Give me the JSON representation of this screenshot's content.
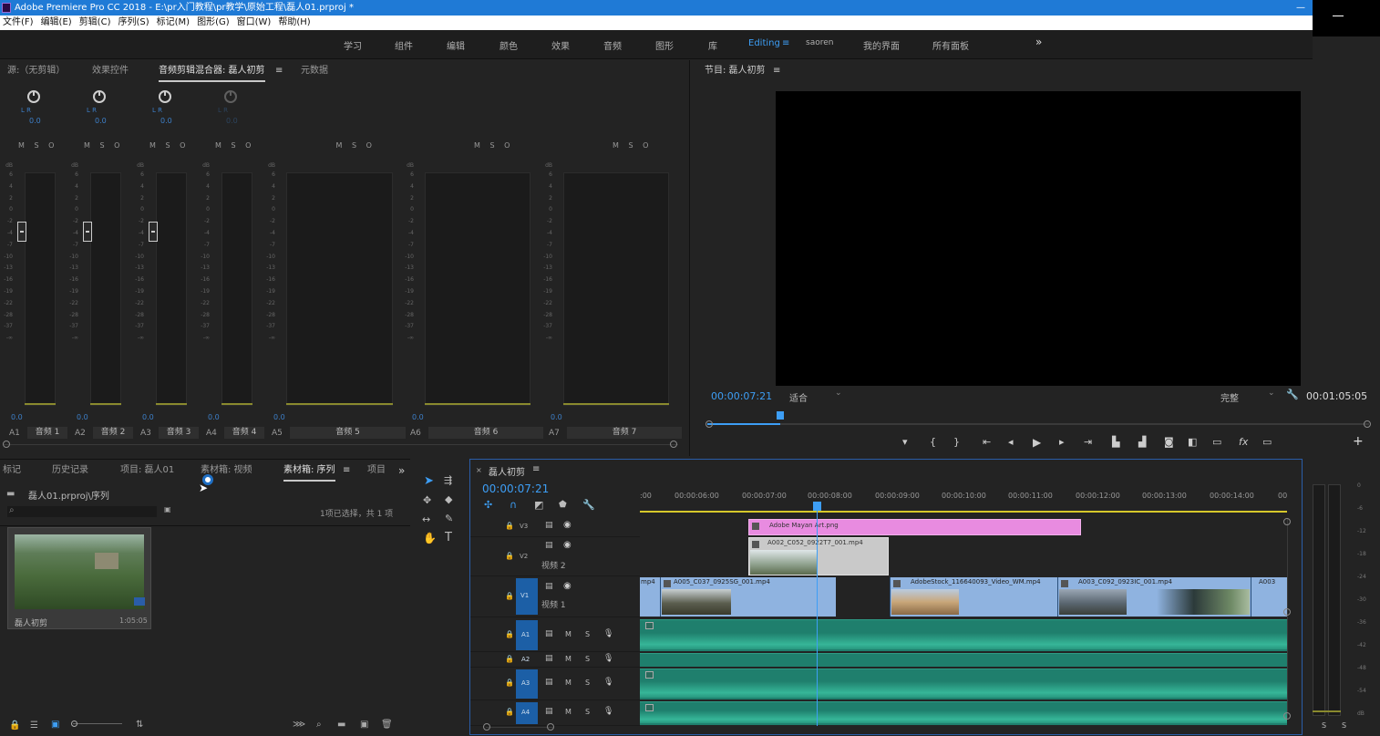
{
  "window": {
    "title": "Adobe Premiere Pro CC 2018 - E:\\pr入门教程\\pr教学\\原始工程\\磊人01.prproj *"
  },
  "menu": [
    "文件(F)",
    "编辑(E)",
    "剪辑(C)",
    "序列(S)",
    "标记(M)",
    "图形(G)",
    "窗口(W)",
    "帮助(H)"
  ],
  "workspaces": [
    "学习",
    "组件",
    "编辑",
    "颜色",
    "效果",
    "音频",
    "图形",
    "库",
    "Editing",
    "saoren",
    "我的界面",
    "所有面板"
  ],
  "workspace_active": "Editing",
  "mixer_tabs": [
    "源:（无剪辑）",
    "效果控件",
    "音频剪辑混合器: 磊人初剪",
    "元数据"
  ],
  "mixer": {
    "pan_label": "L  R",
    "pan_value": "0.0",
    "msr": "M S O",
    "db_label": "dB",
    "scale": [
      "6",
      "4",
      "2",
      "0",
      "-2",
      "-4",
      "-7",
      "-10",
      "-13",
      "-16",
      "-19",
      "-22",
      "-28",
      "-37",
      "-∞"
    ],
    "fader_value": "0.0",
    "channels": [
      {
        "id": "A1",
        "name": "音频 1"
      },
      {
        "id": "A2",
        "name": "音频 2"
      },
      {
        "id": "A3",
        "name": "音频 3"
      },
      {
        "id": "A4",
        "name": "音频 4"
      },
      {
        "id": "A5",
        "name": "音频 5"
      },
      {
        "id": "A6",
        "name": "音频 6"
      },
      {
        "id": "A7",
        "name": "音频 7"
      }
    ]
  },
  "program": {
    "title": "节目: 磊人初剪",
    "timecode": "00:00:07:21",
    "fit": "适合",
    "quality": "完整",
    "duration": "00:01:05:05",
    "playhead_fraction": 0.11
  },
  "project": {
    "tabs": [
      "标记",
      "历史记录",
      "项目: 磊人01",
      "素材箱: 视频",
      "素材箱: 序列",
      "项目"
    ],
    "path": "磊人01.prproj\\序列",
    "selection": "1项已选择，共 1 项",
    "clip_name": "磊人初剪",
    "clip_duration": "1:05:05"
  },
  "timeline": {
    "tab": "磊人初剪",
    "timecode": "00:00:07:21",
    "ruler": [
      ":00",
      "00:00:06:00",
      "00:00:07:00",
      "00:00:08:00",
      "00:00:09:00",
      "00:00:10:00",
      "00:00:11:00",
      "00:00:12:00",
      "00:00:13:00",
      "00:00:14:00",
      "00"
    ],
    "tracks_video": [
      {
        "id": "V3",
        "name": ""
      },
      {
        "id": "V2",
        "name": "视频 2"
      },
      {
        "id": "V1",
        "name": "视频 1"
      }
    ],
    "tracks_audio": [
      "A1",
      "A2",
      "A3",
      "A4"
    ],
    "v1_source": "V1",
    "clips": {
      "mayan": "Adobe Mayan Art.png",
      "a002": "A002_C052_0922T7_001.mp4",
      "v1a": "mp4",
      "a005": "A005_C037_0925SG_001.mp4",
      "stock": "AdobeStock_116640093_Video_WM.mp4",
      "a003": "A003_C092_0923IC_001.mp4",
      "a003b": "A003"
    },
    "msr": {
      "m": "M",
      "s": "S"
    }
  },
  "right_meter": {
    "scale": [
      "0",
      "-6",
      "-12",
      "-18",
      "-24",
      "-30",
      "-36",
      "-42",
      "-48",
      "-54",
      "dB"
    ],
    "solo": [
      "S",
      "S"
    ]
  }
}
